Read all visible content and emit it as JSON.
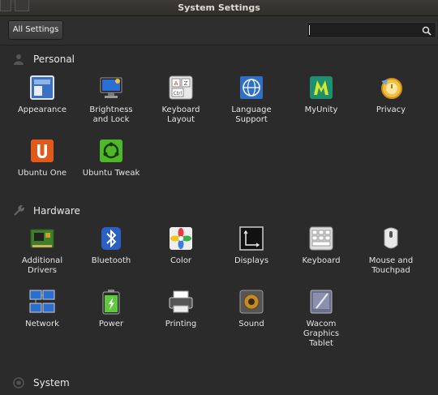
{
  "window": {
    "title": "System Settings"
  },
  "toolbar": {
    "all_settings_label": "All Settings",
    "search_value": "",
    "search_icon": "search-icon"
  },
  "sections": {
    "personal": {
      "title": "Personal",
      "icon": "person-icon",
      "items": [
        {
          "label": "Appearance",
          "icon": "appearance-icon"
        },
        {
          "label": "Brightness\nand Lock",
          "icon": "brightness-icon"
        },
        {
          "label": "Keyboard\nLayout",
          "icon": "keyboard-layout-icon"
        },
        {
          "label": "Language\nSupport",
          "icon": "language-icon"
        },
        {
          "label": "MyUnity",
          "icon": "myunity-icon"
        },
        {
          "label": "Privacy",
          "icon": "privacy-icon"
        },
        {
          "label": "Ubuntu One",
          "icon": "ubuntu-one-icon"
        },
        {
          "label": "Ubuntu Tweak",
          "icon": "ubuntu-tweak-icon"
        }
      ]
    },
    "hardware": {
      "title": "Hardware",
      "icon": "wrench-icon",
      "items": [
        {
          "label": "Additional\nDrivers",
          "icon": "drivers-icon"
        },
        {
          "label": "Bluetooth",
          "icon": "bluetooth-icon"
        },
        {
          "label": "Color",
          "icon": "color-icon"
        },
        {
          "label": "Displays",
          "icon": "displays-icon"
        },
        {
          "label": "Keyboard",
          "icon": "keyboard-icon"
        },
        {
          "label": "Mouse and\nTouchpad",
          "icon": "mouse-icon"
        },
        {
          "label": "Network",
          "icon": "network-icon"
        },
        {
          "label": "Power",
          "icon": "power-icon"
        },
        {
          "label": "Printing",
          "icon": "printer-icon"
        },
        {
          "label": "Sound",
          "icon": "sound-icon"
        },
        {
          "label": "Wacom\nGraphics\nTablet",
          "icon": "wacom-icon"
        }
      ]
    },
    "system": {
      "title": "System",
      "icon": "system-icon"
    }
  }
}
